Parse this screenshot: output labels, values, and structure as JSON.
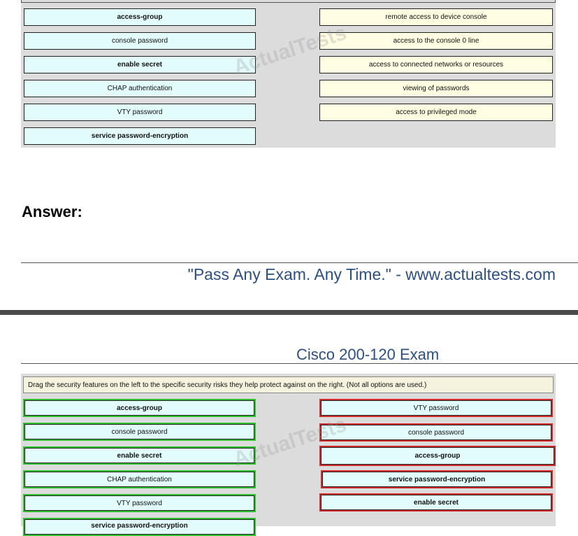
{
  "question": {
    "left_items": [
      "access-group",
      "console password",
      "enable secret",
      "CHAP authentication",
      "VTY password",
      "service password-encryption"
    ],
    "right_items": [
      "remote access to device console",
      "access to the console 0 line",
      "access to connected networks or resources",
      "viewing of passwords",
      "access to privileged mode"
    ]
  },
  "answer_label": "Answer:",
  "footer_text": "\"Pass Any Exam. Any Time.\" - www.actualtests.com",
  "header_title": "Cisco 200-120 Exam",
  "instruction": "Drag the security features on the left to the specific security risks they help protect against on the right. (Not all options are used.)",
  "answer_panel": {
    "left_items": [
      "access-group",
      "console password",
      "enable secret",
      "CHAP authentication",
      "VTY password",
      "service password-encryption"
    ],
    "right_items": [
      "VTY password",
      "console password",
      "access-group",
      "service password-encryption",
      "enable secret"
    ]
  },
  "watermark": "ActualTests"
}
